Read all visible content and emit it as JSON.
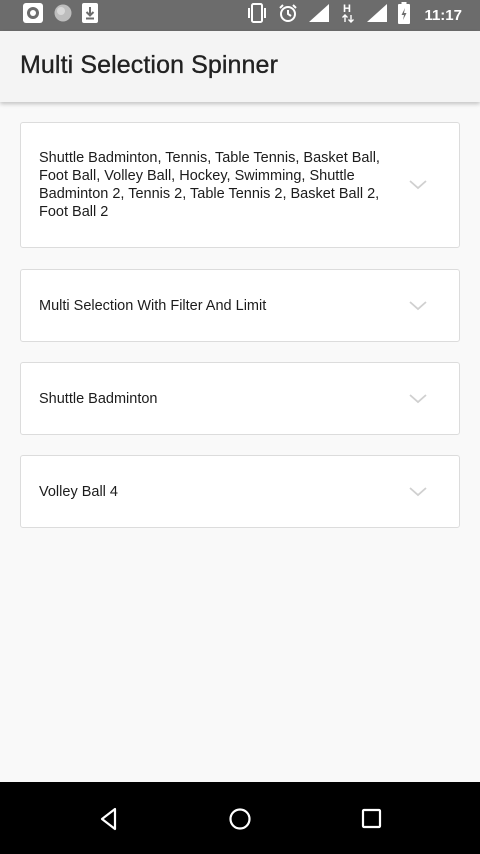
{
  "status_bar": {
    "time": "11:17",
    "left_icons": [
      "record-icon",
      "circle-icon",
      "download-icon"
    ],
    "right_icons": [
      "vibrate-icon",
      "alarm-icon",
      "signal-icon",
      "data-h-icon",
      "signal-icon",
      "battery-icon"
    ]
  },
  "app_bar": {
    "title": "Multi Selection Spinner"
  },
  "spinners": [
    {
      "text": "Shuttle Badminton, Tennis, Table Tennis, Basket Ball, Foot Ball, Volley Ball, Hockey, Swimming, Shuttle Badminton 2, Tennis 2, Table Tennis 2, Basket Ball 2, Foot Ball 2"
    },
    {
      "text": "Multi Selection With Filter And Limit"
    },
    {
      "text": "Shuttle Badminton"
    },
    {
      "text": "Volley Ball 4"
    }
  ],
  "nav_bar": {
    "buttons": [
      "back-icon",
      "home-icon",
      "recents-icon"
    ]
  }
}
